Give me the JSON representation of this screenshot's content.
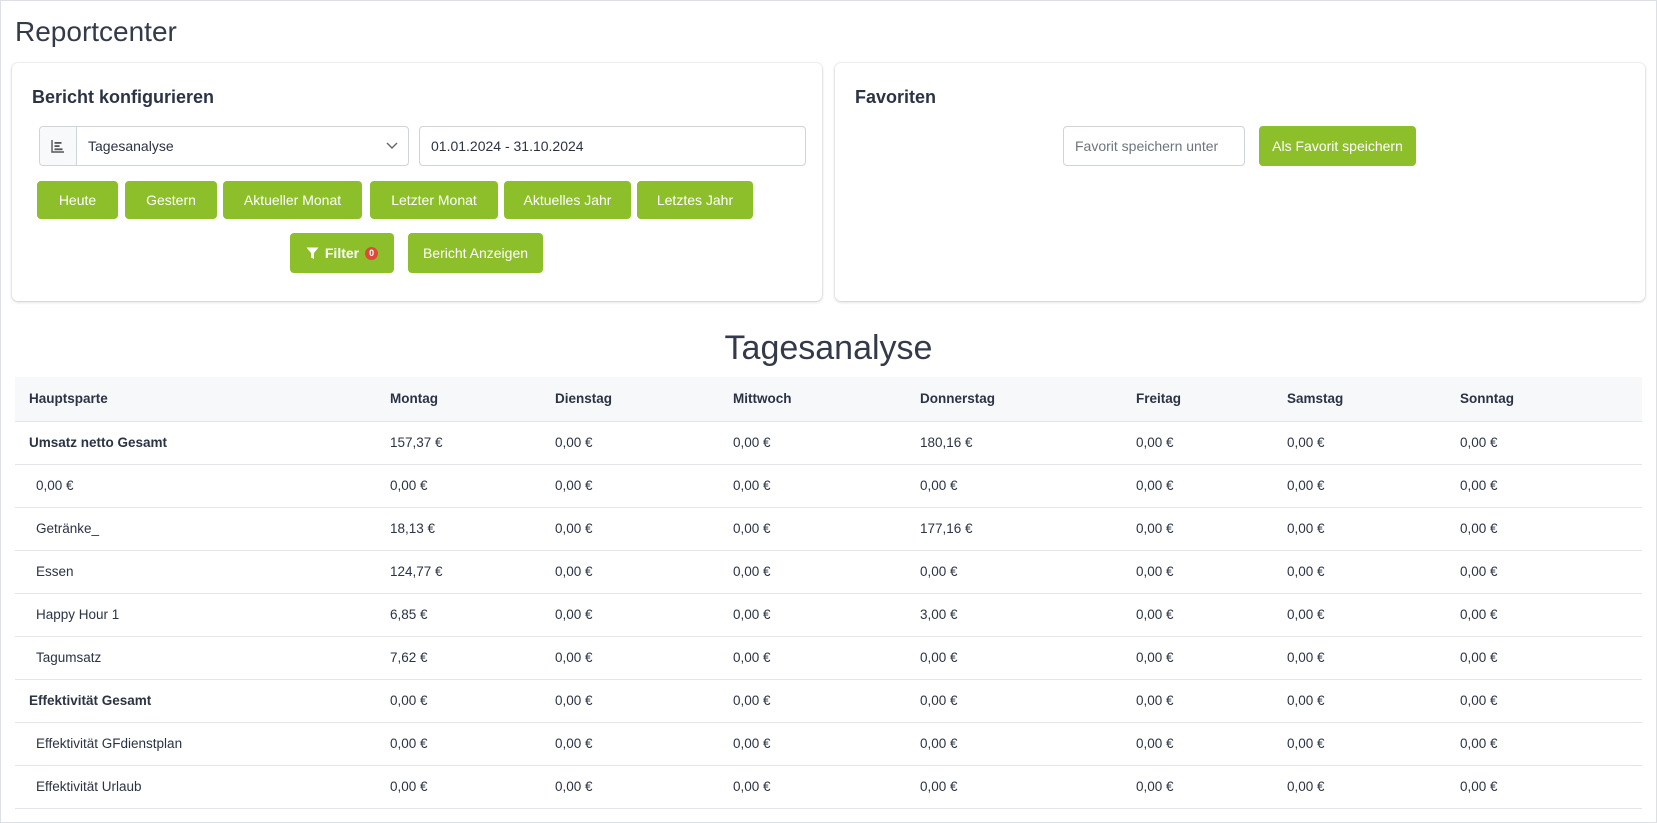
{
  "page": {
    "title": "Reportcenter"
  },
  "config": {
    "title": "Bericht konfigurieren",
    "report_type": {
      "icon": "bar-chart-icon",
      "value": "Tagesanalyse"
    },
    "date_range": "01.01.2024 - 31.10.2024",
    "quick_ranges": [
      "Heute",
      "Gestern",
      "Aktueller Monat",
      "Letzter Monat",
      "Aktuelles Jahr",
      "Letztes Jahr"
    ],
    "filter": {
      "label": "Filter",
      "count": "0",
      "icon": "filter-icon"
    },
    "show_report_label": "Bericht Anzeigen"
  },
  "favorites": {
    "title": "Favoriten",
    "input_placeholder": "Favorit speichern unter",
    "save_label": "Als Favorit speichern"
  },
  "report": {
    "title": "Tagesanalyse",
    "columns": [
      "Hauptsparte",
      "Montag",
      "Dienstag",
      "Mittwoch",
      "Donnerstag",
      "Freitag",
      "Samstag",
      "Sonntag"
    ],
    "rows": [
      {
        "label": "Umsatz netto Gesamt",
        "group": true,
        "values": [
          "157,37 €",
          "0,00 €",
          "0,00 €",
          "180,16 €",
          "0,00 €",
          "0,00 €",
          "0,00 €"
        ]
      },
      {
        "label": "0,00 €",
        "group": false,
        "values": [
          "0,00 €",
          "0,00 €",
          "0,00 €",
          "0,00 €",
          "0,00 €",
          "0,00 €",
          "0,00 €"
        ]
      },
      {
        "label": "Getränke_",
        "group": false,
        "values": [
          "18,13 €",
          "0,00 €",
          "0,00 €",
          "177,16 €",
          "0,00 €",
          "0,00 €",
          "0,00 €"
        ]
      },
      {
        "label": "Essen",
        "group": false,
        "values": [
          "124,77 €",
          "0,00 €",
          "0,00 €",
          "0,00 €",
          "0,00 €",
          "0,00 €",
          "0,00 €"
        ]
      },
      {
        "label": "Happy Hour 1",
        "group": false,
        "values": [
          "6,85 €",
          "0,00 €",
          "0,00 €",
          "3,00 €",
          "0,00 €",
          "0,00 €",
          "0,00 €"
        ]
      },
      {
        "label": "Tagumsatz",
        "group": false,
        "values": [
          "7,62 €",
          "0,00 €",
          "0,00 €",
          "0,00 €",
          "0,00 €",
          "0,00 €",
          "0,00 €"
        ]
      },
      {
        "label": "Effektivität Gesamt",
        "group": true,
        "values": [
          "0,00 €",
          "0,00 €",
          "0,00 €",
          "0,00 €",
          "0,00 €",
          "0,00 €",
          "0,00 €"
        ]
      },
      {
        "label": "Effektivität GFdienstplan",
        "group": false,
        "values": [
          "0,00 €",
          "0,00 €",
          "0,00 €",
          "0,00 €",
          "0,00 €",
          "0,00 €",
          "0,00 €"
        ]
      },
      {
        "label": "Effektivität Urlaub",
        "group": false,
        "values": [
          "0,00 €",
          "0,00 €",
          "0,00 €",
          "0,00 €",
          "0,00 €",
          "0,00 €",
          "0,00 €"
        ]
      }
    ]
  },
  "colors": {
    "accent": "#8cbf2a",
    "badge": "#e2483a",
    "text": "#2b3344"
  }
}
